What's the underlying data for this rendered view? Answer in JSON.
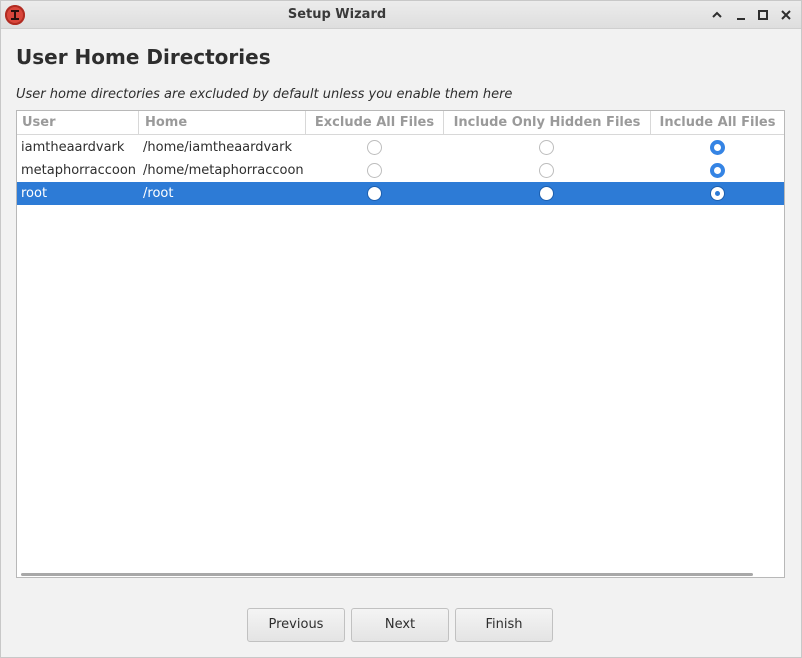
{
  "window": {
    "title": "Setup Wizard",
    "controls": {
      "collapse": "⌃",
      "minimize": "–",
      "maximize": "□",
      "close": "✕"
    }
  },
  "page": {
    "heading": "User Home Directories",
    "description": "User home directories are excluded by default unless you enable them here"
  },
  "table": {
    "columns": [
      "User",
      "Home",
      "Exclude All Files",
      "Include Only Hidden Files",
      "Include All Files"
    ],
    "rows": [
      {
        "user": "iamtheaardvark",
        "home": "/home/iamtheaardvark",
        "option": "Include All Files",
        "selected": false
      },
      {
        "user": "metaphorraccoon",
        "home": "/home/metaphorraccoon",
        "option": "Include All Files",
        "selected": false
      },
      {
        "user": "root",
        "home": "/root",
        "option": "Include All Files",
        "selected": true
      }
    ]
  },
  "buttons": {
    "previous": "Previous",
    "next": "Next",
    "finish": "Finish"
  },
  "colors": {
    "accent": "#3584e4",
    "selection": "#2d7bd6",
    "app_icon": "#d9463b"
  },
  "icons": {
    "app": "timeshift-app-icon"
  }
}
